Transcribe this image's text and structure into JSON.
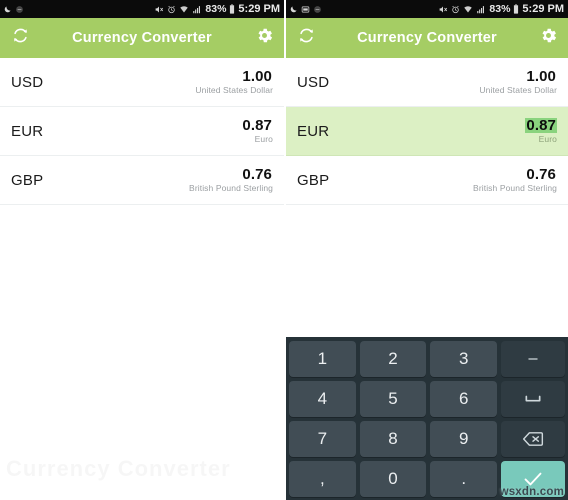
{
  "status_bar": {
    "left_icons_left_panel": [
      "moon-icon",
      "do-not-disturb-icon"
    ],
    "left_icons_right_panel": [
      "moon-icon",
      "keyboard-icon",
      "do-not-disturb-icon"
    ],
    "right_icons": [
      "mute-icon",
      "alarm-icon",
      "wifi-icon",
      "signal-icon",
      "battery-icon"
    ],
    "battery_percent": "83%",
    "time": "5:29 PM"
  },
  "app_bar": {
    "title": "Currency Converter",
    "refresh_icon": "refresh-icon",
    "settings_icon": "gear-icon",
    "background_color": "#a5cd64",
    "title_color": "#ffffff"
  },
  "currencies": [
    {
      "code": "USD",
      "amount": "1.00",
      "name": "United States Dollar",
      "selected": false
    },
    {
      "code": "EUR",
      "amount": "0.87",
      "name": "Euro",
      "selected": false
    },
    {
      "code": "GBP",
      "amount": "0.76",
      "name": "British Pound Sterling",
      "selected": false
    }
  ],
  "currencies_right": [
    {
      "code": "USD",
      "amount": "1.00",
      "name": "United States Dollar",
      "selected": false
    },
    {
      "code": "EUR",
      "amount": "0.87",
      "name": "Euro",
      "selected": true
    },
    {
      "code": "GBP",
      "amount": "0.76",
      "name": "British Pound Sterling",
      "selected": false
    }
  ],
  "selection": {
    "row_background": "#dcf0c4",
    "value_highlight": "#8ad37e"
  },
  "keyboard": {
    "background": "#263238",
    "key_color": "#414d55",
    "fn_key_color": "#2f3b42",
    "confirm_key_color": "#79c9bb",
    "rows": [
      [
        {
          "label": "1",
          "name": "key-1",
          "type": "num"
        },
        {
          "label": "2",
          "name": "key-2",
          "type": "num"
        },
        {
          "label": "3",
          "name": "key-3",
          "type": "num"
        },
        {
          "label": "–",
          "name": "key-minus",
          "type": "fn"
        }
      ],
      [
        {
          "label": "4",
          "name": "key-4",
          "type": "num"
        },
        {
          "label": "5",
          "name": "key-5",
          "type": "num"
        },
        {
          "label": "6",
          "name": "key-6",
          "type": "num"
        },
        {
          "label": "⌴",
          "name": "key-space",
          "type": "fn"
        }
      ],
      [
        {
          "label": "7",
          "name": "key-7",
          "type": "num"
        },
        {
          "label": "8",
          "name": "key-8",
          "type": "num"
        },
        {
          "label": "9",
          "name": "key-9",
          "type": "num"
        },
        {
          "label": "⌫",
          "name": "key-backspace",
          "type": "fn"
        }
      ],
      [
        {
          "label": ",",
          "name": "key-comma",
          "type": "num"
        },
        {
          "label": "0",
          "name": "key-0",
          "type": "num"
        },
        {
          "label": ".",
          "name": "key-period",
          "type": "num"
        },
        {
          "label": "✓",
          "name": "key-confirm",
          "type": "ok"
        }
      ]
    ]
  },
  "watermark": "wsxdn.com",
  "ghost_text": "Currency Converter"
}
